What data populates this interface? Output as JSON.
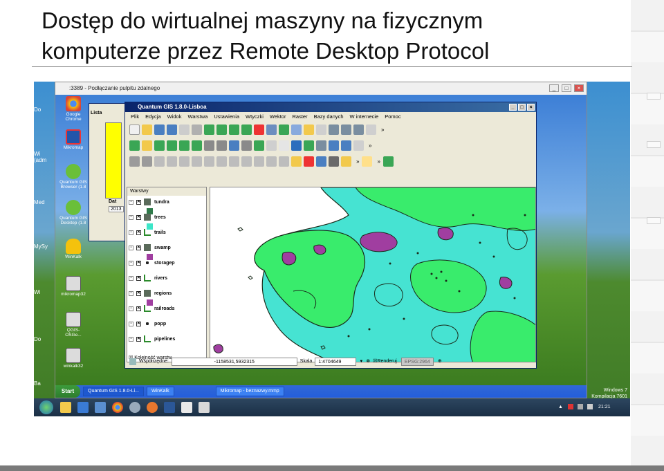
{
  "slide": {
    "title_line1": "Dostęp do wirtualnej maszyny na fizycznym",
    "title_line2": "komputerze przez Remote Desktop Protocol"
  },
  "win7": {
    "desktop_labels": [
      "Do",
      "Wi (adm",
      "Med",
      "MySy",
      "Wi",
      "Do",
      "Ba"
    ],
    "watermark": [
      "Windows 7",
      "Kompilacja 7601"
    ],
    "clock": "21:21",
    "pinned": [
      "explorer-icon",
      "media-player-icon",
      "save-icon",
      "chrome-icon",
      "network-icon",
      "firefox-icon",
      "word-icon",
      "document-icon",
      "paint-icon"
    ]
  },
  "rdp": {
    "title": ":3389 - Podłączanie pulpitu zdalnego",
    "controls": [
      "_",
      "□",
      "×"
    ]
  },
  "xp": {
    "icons": [
      {
        "label": "Google Chrome",
        "icon": "chrome-icon"
      },
      {
        "label": "Mikromap",
        "icon": "mikromap-icon"
      },
      {
        "label": "Quantum GIS Browser (1.8",
        "icon": "qgis-browser-icon"
      },
      {
        "label": "Quantum GIS Desktop (1.8",
        "icon": "qgis-desktop-icon"
      },
      {
        "label": "WinKalk",
        "icon": "winkalk-icon"
      },
      {
        "label": "mikromap32",
        "icon": "mikromap32-icon"
      },
      {
        "label": "QGIS-OSGe...",
        "icon": "qgis-osgeo-icon"
      },
      {
        "label": "winkalk32",
        "icon": "winkalk32-icon"
      }
    ],
    "bg_window": {
      "tab_label": "Lista",
      "date_label": "Dat",
      "date_value": "2013"
    },
    "taskbar": {
      "start": "Start",
      "tasks": [
        "Quantum GIS 1.8.0-Li...",
        "WinKalk",
        "Mikromap - beznazwy.mmp"
      ]
    }
  },
  "qgis": {
    "title": "Quantum GIS 1.8.0-Lisboa",
    "menu": [
      "Plik",
      "Edycja",
      "Widok",
      "Warstwa",
      "Ustawienia",
      "Wtyczki",
      "Wektor",
      "Raster",
      "Bazy danych",
      "W internecie",
      "Pomoc"
    ],
    "legend_header": "Warstwy",
    "layers": [
      {
        "name": "tundra",
        "color": "#2f7a4a"
      },
      {
        "name": "trees",
        "color": "#3ce6c8"
      },
      {
        "name": "trails",
        "color": "#2a8a2a"
      },
      {
        "name": "swamp",
        "color": "#4b4b4b"
      },
      {
        "name": "storagep",
        "color": "#1a1a1a"
      },
      {
        "name": "rivers",
        "color": "#2a8a2a"
      },
      {
        "name": "regions",
        "color": "#4b4b4b"
      },
      {
        "name": "railroads",
        "color": "#2a8a2a"
      },
      {
        "name": "popp",
        "color": "#1a1a1a"
      },
      {
        "name": "pipelines",
        "color": "#2a8a2a"
      }
    ],
    "legend_footer": "Kolejność warstw",
    "status": {
      "coord_label": "Współrzędne:",
      "coord_value": "-1158531,5932315",
      "scale_label": "Skala",
      "scale_value": "1:4704649",
      "render_label": "Renderuj",
      "epsg": "EPSG:2964"
    },
    "map_colors": {
      "land_cyan": "#46e3d2",
      "land_green": "#39ec6c",
      "swamp": "#a03ea0",
      "outline": "#1a2a1a"
    }
  }
}
